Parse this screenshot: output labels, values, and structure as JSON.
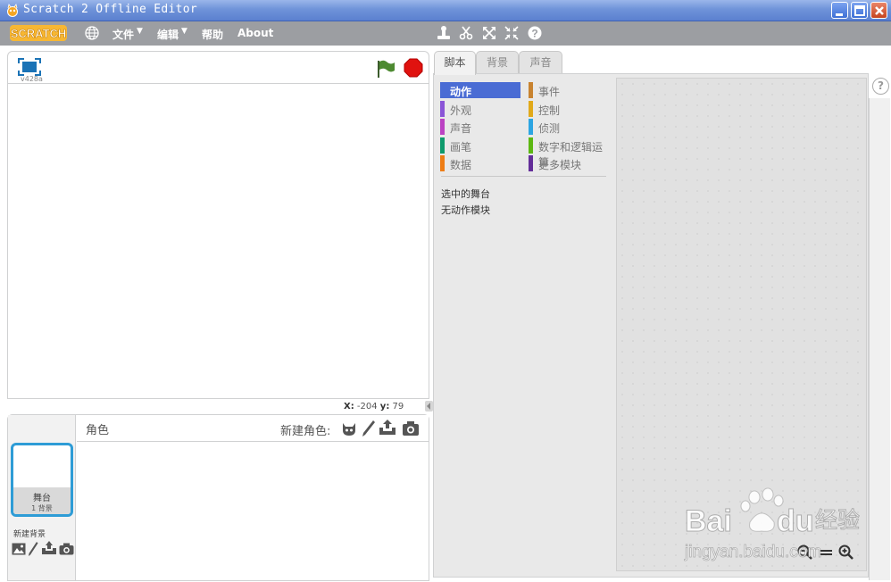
{
  "window": {
    "title": "Scratch 2 Offline Editor"
  },
  "menubar": {
    "logo_text": "SCRATCH",
    "items": [
      {
        "label": "文件",
        "has_arrow": true
      },
      {
        "label": "编辑",
        "has_arrow": true
      },
      {
        "label": "帮助",
        "has_arrow": false
      },
      {
        "label": "About",
        "has_arrow": false
      }
    ],
    "tools": [
      "duplicate-stamp-icon",
      "cut-scissors-icon",
      "grow-icon",
      "shrink-icon",
      "help-icon"
    ]
  },
  "stage": {
    "version": "v428a",
    "mouse_x_label": "X:",
    "mouse_x": "-204",
    "mouse_y_label": "y:",
    "mouse_y": "79"
  },
  "sprites": {
    "label": "角色",
    "new_sprite_label": "新建角色:",
    "stage_thumb_name": "舞台",
    "stage_thumb_sub": "1 背景",
    "new_backdrop_label": "新建背景"
  },
  "tabs": [
    {
      "label": "脚本",
      "active": true
    },
    {
      "label": "背景",
      "active": false
    },
    {
      "label": "声音",
      "active": false
    }
  ],
  "categories": [
    {
      "label": "动作",
      "color": "#4a6cd4",
      "selected": true
    },
    {
      "label": "外观",
      "color": "#8a55d7",
      "selected": false
    },
    {
      "label": "声音",
      "color": "#bb42c3",
      "selected": false
    },
    {
      "label": "画笔",
      "color": "#0e9a6c",
      "selected": false
    },
    {
      "label": "数据",
      "color": "#ee7d16",
      "selected": false
    },
    {
      "label": "事件",
      "color": "#c88330",
      "selected": false
    },
    {
      "label": "控制",
      "color": "#e1a91a",
      "selected": false
    },
    {
      "label": "侦测",
      "color": "#2ca5e2",
      "selected": false
    },
    {
      "label": "数字和逻辑运算",
      "color": "#5cb712",
      "selected": false
    },
    {
      "label": "更多模块",
      "color": "#632d99",
      "selected": false
    }
  ],
  "palette": {
    "selected_target": "选中的舞台",
    "no_blocks": "无动作模块"
  },
  "help_label": "?",
  "watermark": {
    "brand": "Bai",
    "brand2": "du",
    "cn": "经验",
    "url": "jingyan.baidu.com"
  }
}
